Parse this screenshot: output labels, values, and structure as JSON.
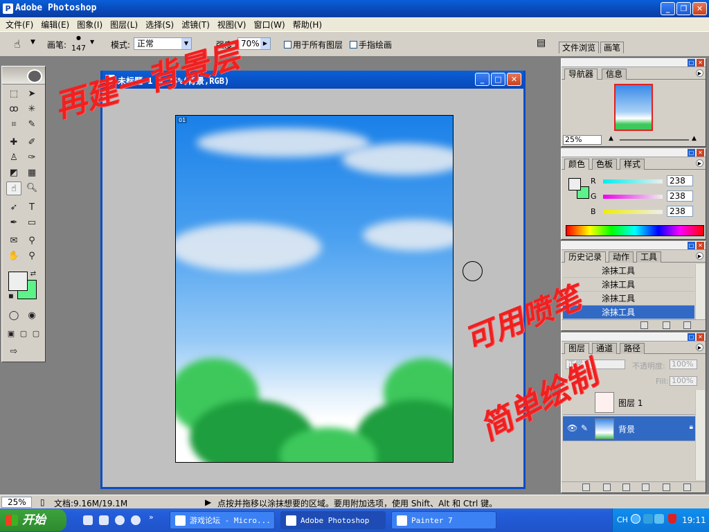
{
  "app": {
    "title": "Adobe Photoshop"
  },
  "menu": [
    "文件(F)",
    "编辑(E)",
    "图象(I)",
    "图层(L)",
    "选择(S)",
    "滤镜(T)",
    "视图(V)",
    "窗口(W)",
    "帮助(H)"
  ],
  "options": {
    "brush_label": "画笔:",
    "brush_size": "147",
    "mode_label": "模式:",
    "mode_value": "正常",
    "strength_label": "强度:",
    "strength_value": "70%",
    "all_layers_label": "用于所有图层",
    "finger_paint_label": "手指绘画",
    "well_tabs": [
      "文件浏览",
      "画笔"
    ]
  },
  "document": {
    "title": "未标题-1 @ 25%(背景,RGB)",
    "layer_badge": "01"
  },
  "navigator": {
    "tabs": [
      "导航器",
      "信息"
    ],
    "zoom": "25%"
  },
  "color": {
    "tabs": [
      "颜色",
      "色板",
      "样式"
    ],
    "channels": [
      {
        "label": "R",
        "value": "238"
      },
      {
        "label": "G",
        "value": "238"
      },
      {
        "label": "B",
        "value": "238"
      }
    ],
    "foreground": "#eeeeee",
    "background": "#5ef28a"
  },
  "history": {
    "tabs": [
      "历史记录",
      "动作",
      "工具"
    ],
    "items": [
      "涂抹工具",
      "涂抹工具",
      "涂抹工具",
      "涂抹工具"
    ]
  },
  "layers": {
    "tabs": [
      "图层",
      "通道",
      "路径"
    ],
    "blend_mode": "正常",
    "opacity_label": "不透明度:",
    "opacity_value": "100%",
    "fill_label": "Fill:",
    "fill_value": "100%",
    "items": [
      {
        "name": "图层 1",
        "active": false
      },
      {
        "name": "背景",
        "active": true
      }
    ]
  },
  "status": {
    "zoom": "25%",
    "doc_size": "文档:9.16M/19.1M",
    "hint": "点按并拖移以涂抹想要的区域。要用附加选项，使用 Shift、Alt 和 Ctrl 键。"
  },
  "taskbar": {
    "start_label": "开始",
    "tasks": [
      {
        "label": "游戏论坛 - Micro...",
        "active": false
      },
      {
        "label": "Adobe Photoshop",
        "active": true
      },
      {
        "label": "Painter 7",
        "active": false
      }
    ],
    "tray_lang": "CH",
    "clock": "19:11"
  },
  "annotations": {
    "top": "再建一背景层",
    "right1": "可用喷笔",
    "right2": "简单绘制"
  }
}
